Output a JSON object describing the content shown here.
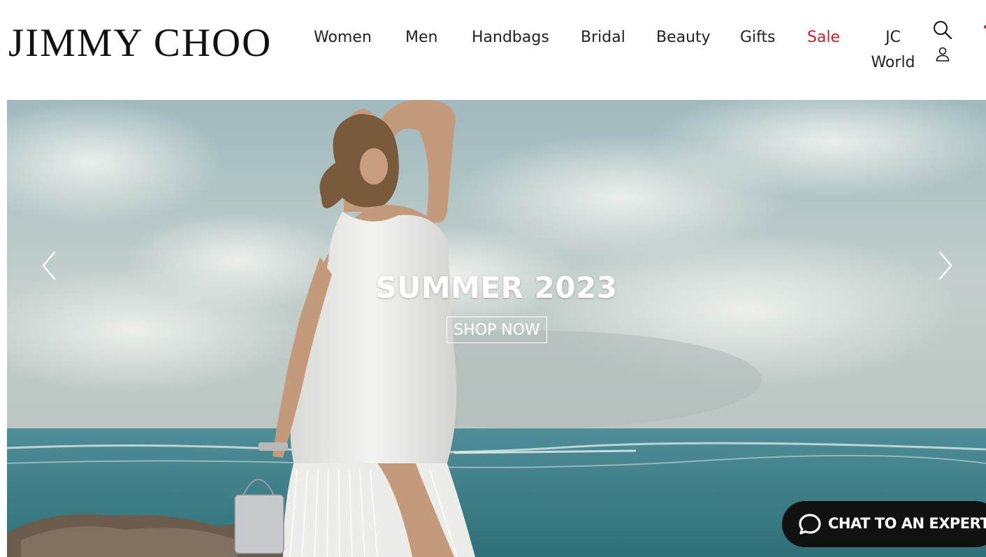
{
  "brand": {
    "logo_text": "JIMMY CHOO"
  },
  "nav": {
    "items": [
      {
        "label": "Women"
      },
      {
        "label": "Men"
      },
      {
        "label": "Handbags"
      },
      {
        "label": "Bridal"
      },
      {
        "label": "Beauty"
      },
      {
        "label": "Gifts"
      },
      {
        "label": "Sale"
      }
    ],
    "jc_world": {
      "line1": "JC",
      "line2": "World"
    }
  },
  "icons": {
    "search": "search-icon",
    "account": "user-icon",
    "prev": "chevron-left-icon",
    "next": "chevron-right-icon",
    "chat": "chat-bubble-icon"
  },
  "hero": {
    "title": "SUMMER 2023",
    "cta_label": "SHOP NOW"
  },
  "chat": {
    "label": "CHAT TO AN EXPERT"
  },
  "colors": {
    "sale": "#c8202f",
    "text": "#222222",
    "chat_bg": "#111111"
  }
}
